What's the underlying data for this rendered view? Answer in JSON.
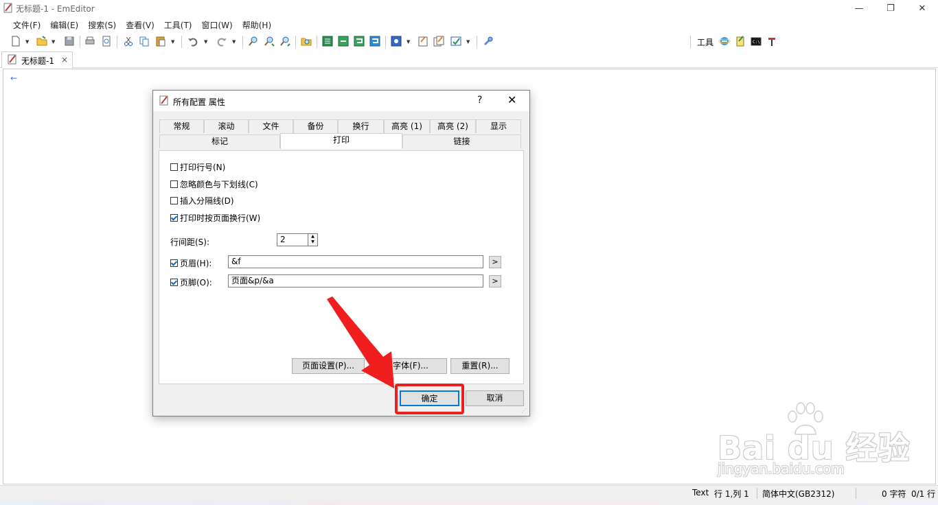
{
  "window": {
    "title": "无标题-1 - EmEditor",
    "minimize_glyph": "—",
    "restore_glyph": "❐",
    "close_glyph": "✕"
  },
  "menu": [
    "文件(F)",
    "编辑(E)",
    "搜索(S)",
    "查看(V)",
    "工具(T)",
    "窗口(W)",
    "帮助(H)"
  ],
  "toolbar": {
    "tools_label": "工具"
  },
  "doc_tab": {
    "label": "无标题-1",
    "close": "×"
  },
  "editor": {
    "cursor_glyph": "←"
  },
  "dialog": {
    "title": "所有配置 属性",
    "help": "?",
    "close": "✕",
    "tabs_row1": [
      "常规",
      "滚动",
      "文件",
      "备份",
      "换行",
      "高亮 (1)",
      "高亮 (2)",
      "显示"
    ],
    "tabs_row2": [
      "标记",
      "打印",
      "链接"
    ],
    "active_tab": "打印",
    "checkboxes": [
      {
        "label": "打印行号(N)",
        "checked": false
      },
      {
        "label": "忽略颜色与下划线(C)",
        "checked": false
      },
      {
        "label": "插入分隔线(D)",
        "checked": false
      },
      {
        "label": "打印时按页面换行(W)",
        "checked": true
      }
    ],
    "line_spacing_label": "行间距(S):",
    "line_spacing_value": "2",
    "header": {
      "label": "页眉(H):",
      "checked": true,
      "value": "&f",
      "button": ">"
    },
    "footer": {
      "label": "页脚(O):",
      "checked": true,
      "value": "页面&p/&a",
      "button": ">"
    },
    "page_setup_button": "页面设置(P)...",
    "font_button": "字体(F)...",
    "reset_button": "重置(R)...",
    "ok_button": "确定",
    "cancel_button": "取消"
  },
  "status": {
    "mode": "Text",
    "position": "行 1,列 1",
    "encoding": "简体中文(GB2312)",
    "chars": "0 字符",
    "lines": "0/1 行"
  },
  "watermark": {
    "logo": "Bai du 经验",
    "url": "jingyan.baidu.com"
  },
  "colors": {
    "accent": "#0078d7",
    "highlight_red": "#e8201f"
  }
}
